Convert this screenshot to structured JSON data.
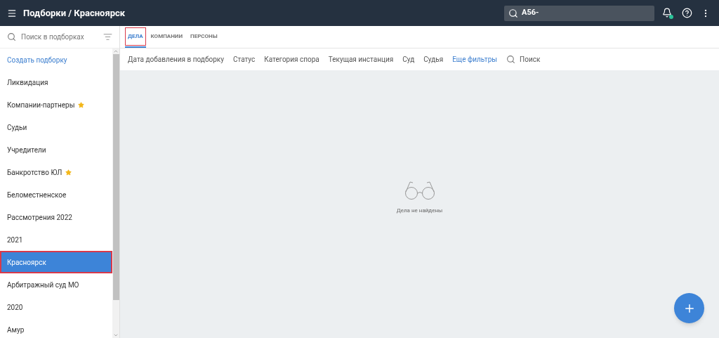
{
  "header": {
    "title": "Подборки / Красноярск",
    "search_value": "А56-",
    "notification_dot": true
  },
  "sidebar": {
    "search_placeholder": "Поиск в подборках",
    "items": [
      {
        "label": "Создать подборку",
        "kind": "create",
        "starred": false,
        "selected": false
      },
      {
        "label": "Ликвидация",
        "kind": "folder",
        "starred": false,
        "selected": false
      },
      {
        "label": "Компании-партнеры",
        "kind": "folder",
        "starred": true,
        "selected": false
      },
      {
        "label": "Судьи",
        "kind": "folder",
        "starred": false,
        "selected": false
      },
      {
        "label": "Учредители",
        "kind": "folder",
        "starred": false,
        "selected": false
      },
      {
        "label": "Банкротство ЮЛ",
        "kind": "folder",
        "starred": true,
        "selected": false
      },
      {
        "label": "Беломестненское",
        "kind": "folder",
        "starred": false,
        "selected": false
      },
      {
        "label": "Рассмотрения 2022",
        "kind": "folder",
        "starred": false,
        "selected": false
      },
      {
        "label": "2021",
        "kind": "folder",
        "starred": false,
        "selected": false
      },
      {
        "label": "Красноярск",
        "kind": "folder",
        "starred": false,
        "selected": true
      },
      {
        "label": "Арбитражный суд МО",
        "kind": "folder",
        "starred": false,
        "selected": false
      },
      {
        "label": "2020",
        "kind": "folder",
        "starred": false,
        "selected": false
      },
      {
        "label": "Амур",
        "kind": "folder",
        "starred": false,
        "selected": false
      }
    ]
  },
  "tabs": [
    {
      "label": "ДЕЛА",
      "selected": true
    },
    {
      "label": "КОМПАНИИ",
      "selected": false
    },
    {
      "label": "ПЕРСОНЫ",
      "selected": false
    }
  ],
  "filters": [
    {
      "label": "Дата добавления в подборку",
      "kind": "filter"
    },
    {
      "label": "Статус",
      "kind": "filter"
    },
    {
      "label": "Категория спора",
      "kind": "filter"
    },
    {
      "label": "Текущая инстанция",
      "kind": "filter"
    },
    {
      "label": "Суд",
      "kind": "filter"
    },
    {
      "label": "Судья",
      "kind": "filter"
    },
    {
      "label": "Еще фильтры",
      "kind": "link"
    },
    {
      "label": "Поиск",
      "kind": "search"
    }
  ],
  "empty_state": {
    "message": "Дела не найдены"
  }
}
